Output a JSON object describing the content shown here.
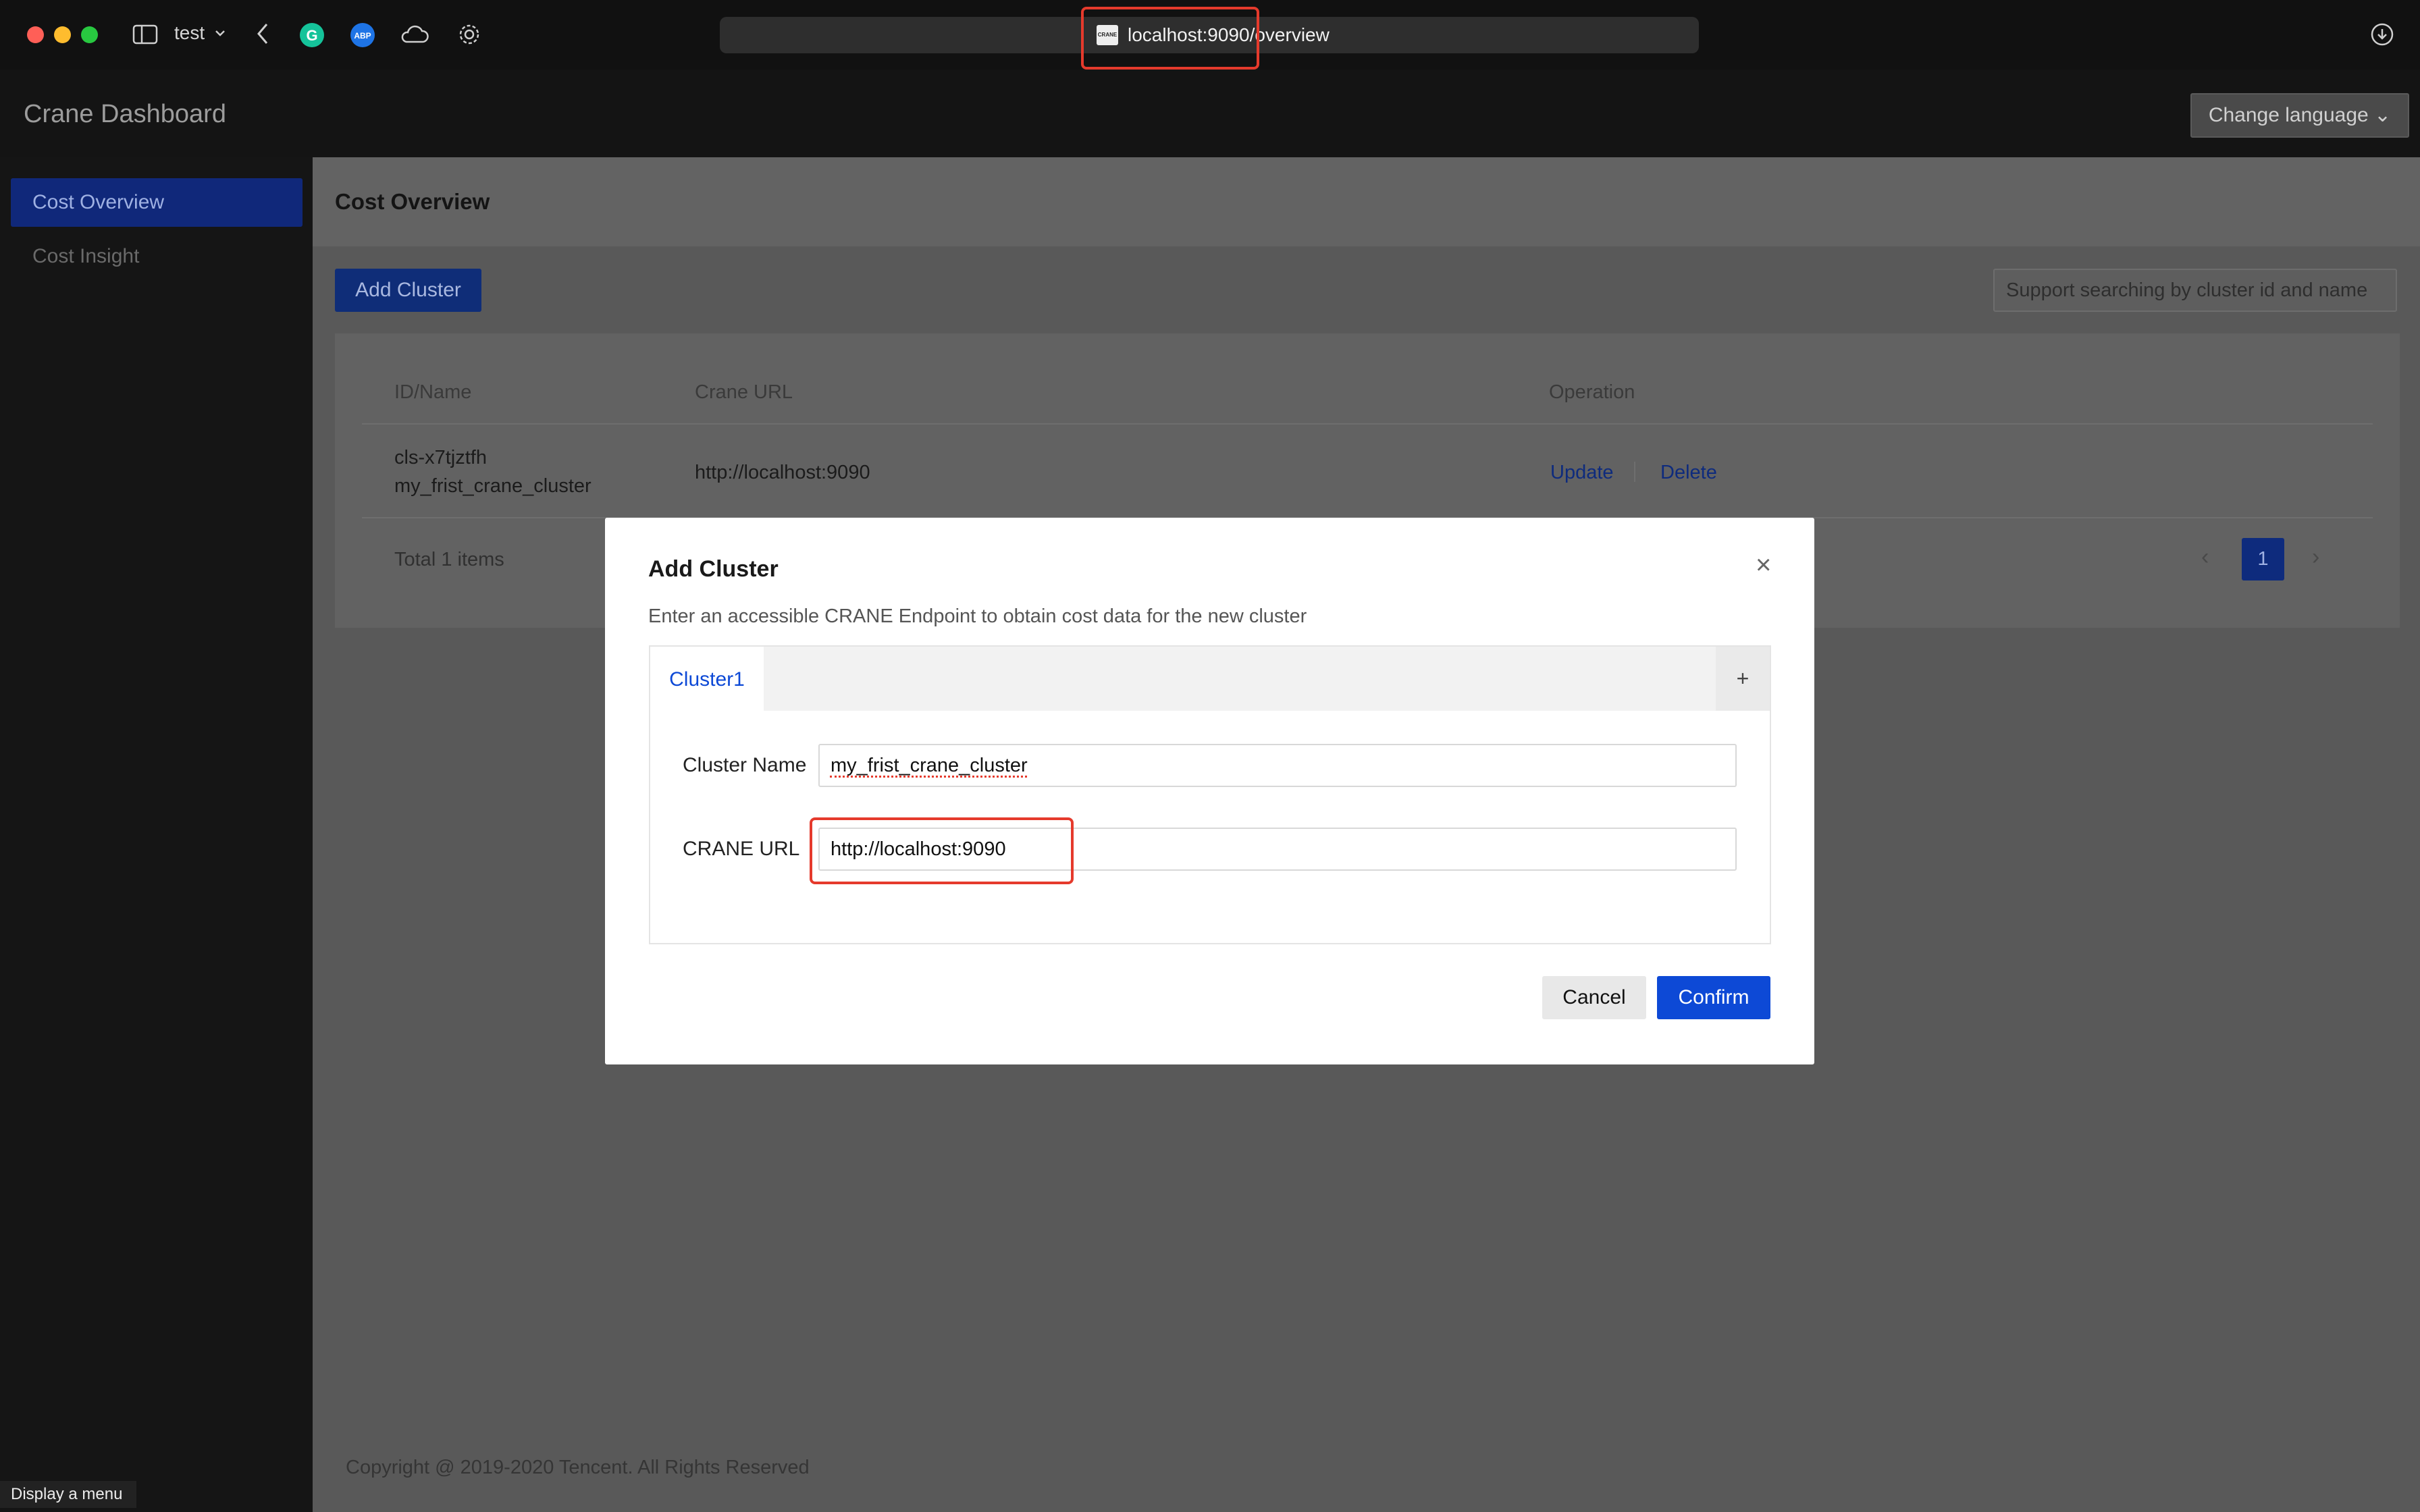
{
  "browser": {
    "profile_label": "test",
    "url": "localhost:9090/overview",
    "favicon_text": "CRANE",
    "traffic_colors": {
      "close": "#ff5f57",
      "minimize": "#febc2e",
      "maximize": "#28c840"
    },
    "icons": [
      "sidebar-toggle-icon",
      "chevron-down-icon",
      "back-arrow-icon",
      "grammarly-icon",
      "adblock-icon",
      "cloud-icon",
      "gear-icon",
      "download-icon"
    ]
  },
  "app": {
    "title": "Crane Dashboard",
    "language_button": "Change language"
  },
  "sidebar": {
    "items": [
      {
        "label": "Cost Overview",
        "active": true
      },
      {
        "label": "Cost Insight",
        "active": false
      }
    ]
  },
  "page": {
    "title": "Cost Overview",
    "add_button": "Add Cluster",
    "search_placeholder": "Support searching by cluster id and name",
    "table": {
      "columns": [
        "ID/Name",
        "Crane URL",
        "Operation"
      ],
      "rows": [
        {
          "id": "cls-x7tjztfh",
          "name": "my_frist_crane_cluster",
          "url": "http://localhost:9090",
          "actions": [
            "Update",
            "Delete"
          ]
        }
      ]
    },
    "total": "Total 1 items",
    "current_page": "1",
    "footer": "Copyright @ 2019-2020 Tencent. All Rights Reserved"
  },
  "modal": {
    "title": "Add Cluster",
    "description": "Enter an accessible CRANE Endpoint to obtain cost data for the new cluster",
    "tabs": [
      "Cluster1"
    ],
    "add_tab": "+",
    "form": {
      "name_label": "Cluster Name",
      "name_value": "my_frist_crane_cluster",
      "url_label": "CRANE URL",
      "url_value": "http://localhost:9090"
    },
    "cancel": "Cancel",
    "confirm": "Confirm"
  },
  "tooltip": "Display a menu",
  "colors": {
    "accent": "#0d49d6",
    "highlight": "#e53a2c"
  }
}
